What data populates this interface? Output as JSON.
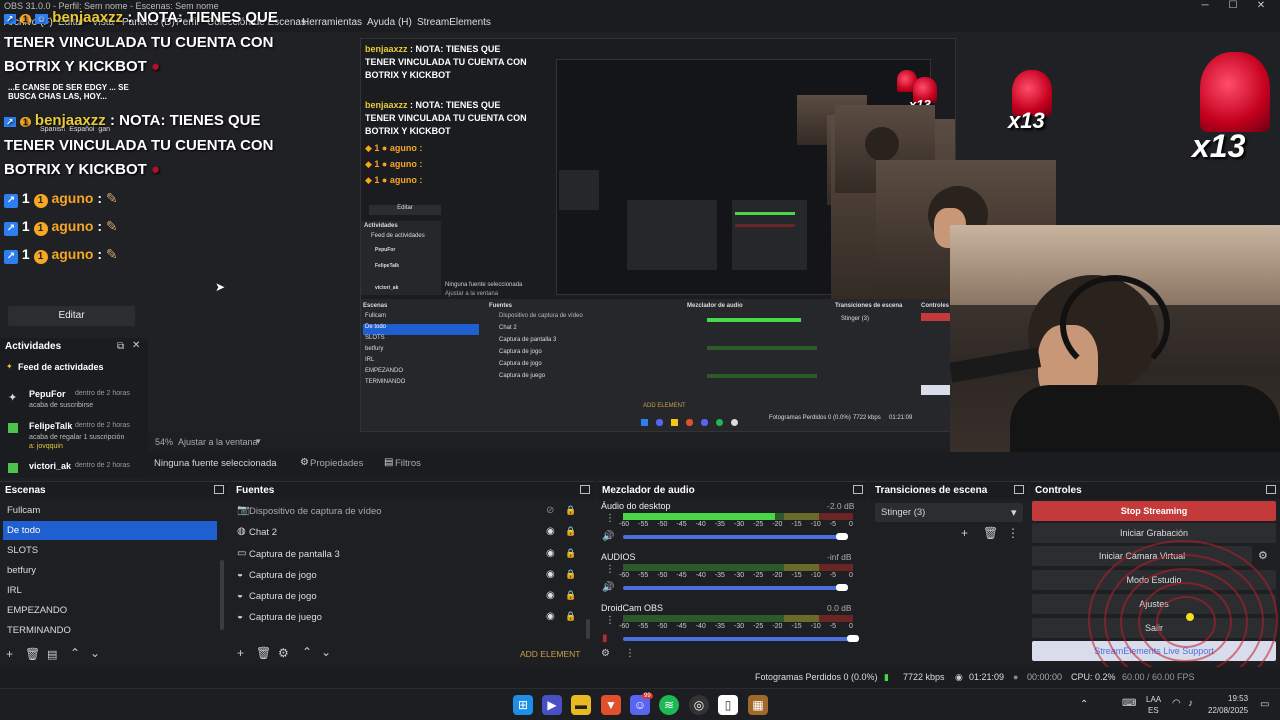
{
  "window": {
    "title": "OBS 31.0.0 - Perfil: Sem nome - Escenas: Sem nome",
    "minimize": "─",
    "maximize": "☐",
    "close": "✕"
  },
  "menu": [
    "Archivo (F)",
    "Editar",
    "Vista",
    "Paneles (D)",
    "Perfil",
    "Colección de Escenas",
    "Herramientas",
    "Ayuda (H)",
    "StreamElements"
  ],
  "chat": {
    "user": "benjaaxzz",
    "message_line1": ": NOTA: TIENES QUE",
    "message_line2": "TENER VINCULADA TU CUENTA CON",
    "message_line3": "BOTRIX Y KICKBOT",
    "aguno_user": "aguno",
    "aguno_colon": ":",
    "aguno_badge1": "1",
    "aguno_badge2": "1",
    "small_line1": "...E CANSE DE SER EDGY ... SE",
    "small_line2": "BUSCA CHAS LAS, HOY...",
    "lang1": "Spanish",
    "lang2": "Español",
    "lang3": "gan"
  },
  "editar_button": "Editar",
  "activities": {
    "title": "Actividades",
    "feed_title": "Feed de actividades",
    "items": [
      {
        "name": "PepuFor",
        "time": "dentro de 2 horas",
        "desc": "acaba de suscribirse",
        "desc2": "",
        "icon_color": "#cfcfcf"
      },
      {
        "name": "FelipeTalk",
        "time": "dentro de 2 horas",
        "desc": "acaba de regalar 1 suscripción",
        "desc2": "a: jovqquin",
        "icon_color": "#4ec24e"
      },
      {
        "name": "victori_ak",
        "time": "dentro de 2 horas",
        "desc": "",
        "desc2": "",
        "icon_color": "#4ec24e"
      }
    ]
  },
  "preview": {
    "zoom": "54%",
    "fit": "Ajustar a la ventana",
    "x13": "x13"
  },
  "source_bar": {
    "none_selected": "Ninguna fuente seleccionada",
    "properties": "Propiedades",
    "filters": "Filtros"
  },
  "scenes": {
    "title": "Escenas",
    "items": [
      "Fullcam",
      "De todo",
      "SLOTS",
      "betfury",
      "IRL",
      "EMPEZANDO",
      "TERMINANDO"
    ],
    "selected_index": 1
  },
  "sources": {
    "title": "Fuentes",
    "items": [
      {
        "icon": "camera",
        "label": "Dispositivo de captura de vídeo",
        "hidden": true
      },
      {
        "icon": "globe",
        "label": "Chat 2",
        "hidden": false
      },
      {
        "icon": "monitor",
        "label": "Captura de pantalla 3",
        "hidden": false
      },
      {
        "icon": "gamepad",
        "label": "Captura de jogo",
        "hidden": false
      },
      {
        "icon": "gamepad",
        "label": "Captura de jogo",
        "hidden": false
      },
      {
        "icon": "gamepad",
        "label": "Captura de juego",
        "hidden": false
      }
    ],
    "add_element": "ADD ELEMENT"
  },
  "mixer": {
    "title": "Mezclador de audio",
    "scale": [
      "-60",
      "-55",
      "-50",
      "-45",
      "-40",
      "-35",
      "-30",
      "-25",
      "-20",
      "-15",
      "-10",
      "-5",
      "0"
    ],
    "channels": [
      {
        "name": "Áudio do desktop",
        "db": "-2.0 dB",
        "level": 0.78,
        "volume": 0.95
      },
      {
        "name": "AUDIOS",
        "db": "-inf dB",
        "level": 0,
        "volume": 0.95
      },
      {
        "name": "DroidCam OBS",
        "db": "0.0 dB",
        "level": 0,
        "volume": 1.0
      }
    ]
  },
  "transitions": {
    "title": "Transiciones de escena",
    "selected": "Stinger (3)"
  },
  "controls": {
    "title": "Controles",
    "stop_streaming": "Stop Streaming",
    "start_recording": "Iniciar Grabación",
    "start_virtual_cam": "Iniciar Cámara Virtual",
    "studio_mode": "Modo Estudio",
    "settings": "Ajustes",
    "exit": "Salir",
    "support": "StreamElements Live Support"
  },
  "status": {
    "dropped_frames": "Fotogramas Perdidos 0 (0.0%)",
    "kbps": "7722 kbps",
    "stream_time": "01:21:09",
    "rec_time": "00:00:00",
    "cpu": "CPU: 0.2%",
    "fps": "60.00 / 60.00 FPS"
  },
  "taskbar": {
    "lang": "ES",
    "lang2": "LAA",
    "time": "19:53",
    "date": "22/08/2025",
    "discord_badge": "99"
  },
  "colors": {
    "accent_blue": "#1f5fd0",
    "stop_red": "#c43a3a",
    "meter_green": "#49d64a",
    "chat_name_yellow": "#e8c93b",
    "aguno_orange": "#f5a623"
  }
}
